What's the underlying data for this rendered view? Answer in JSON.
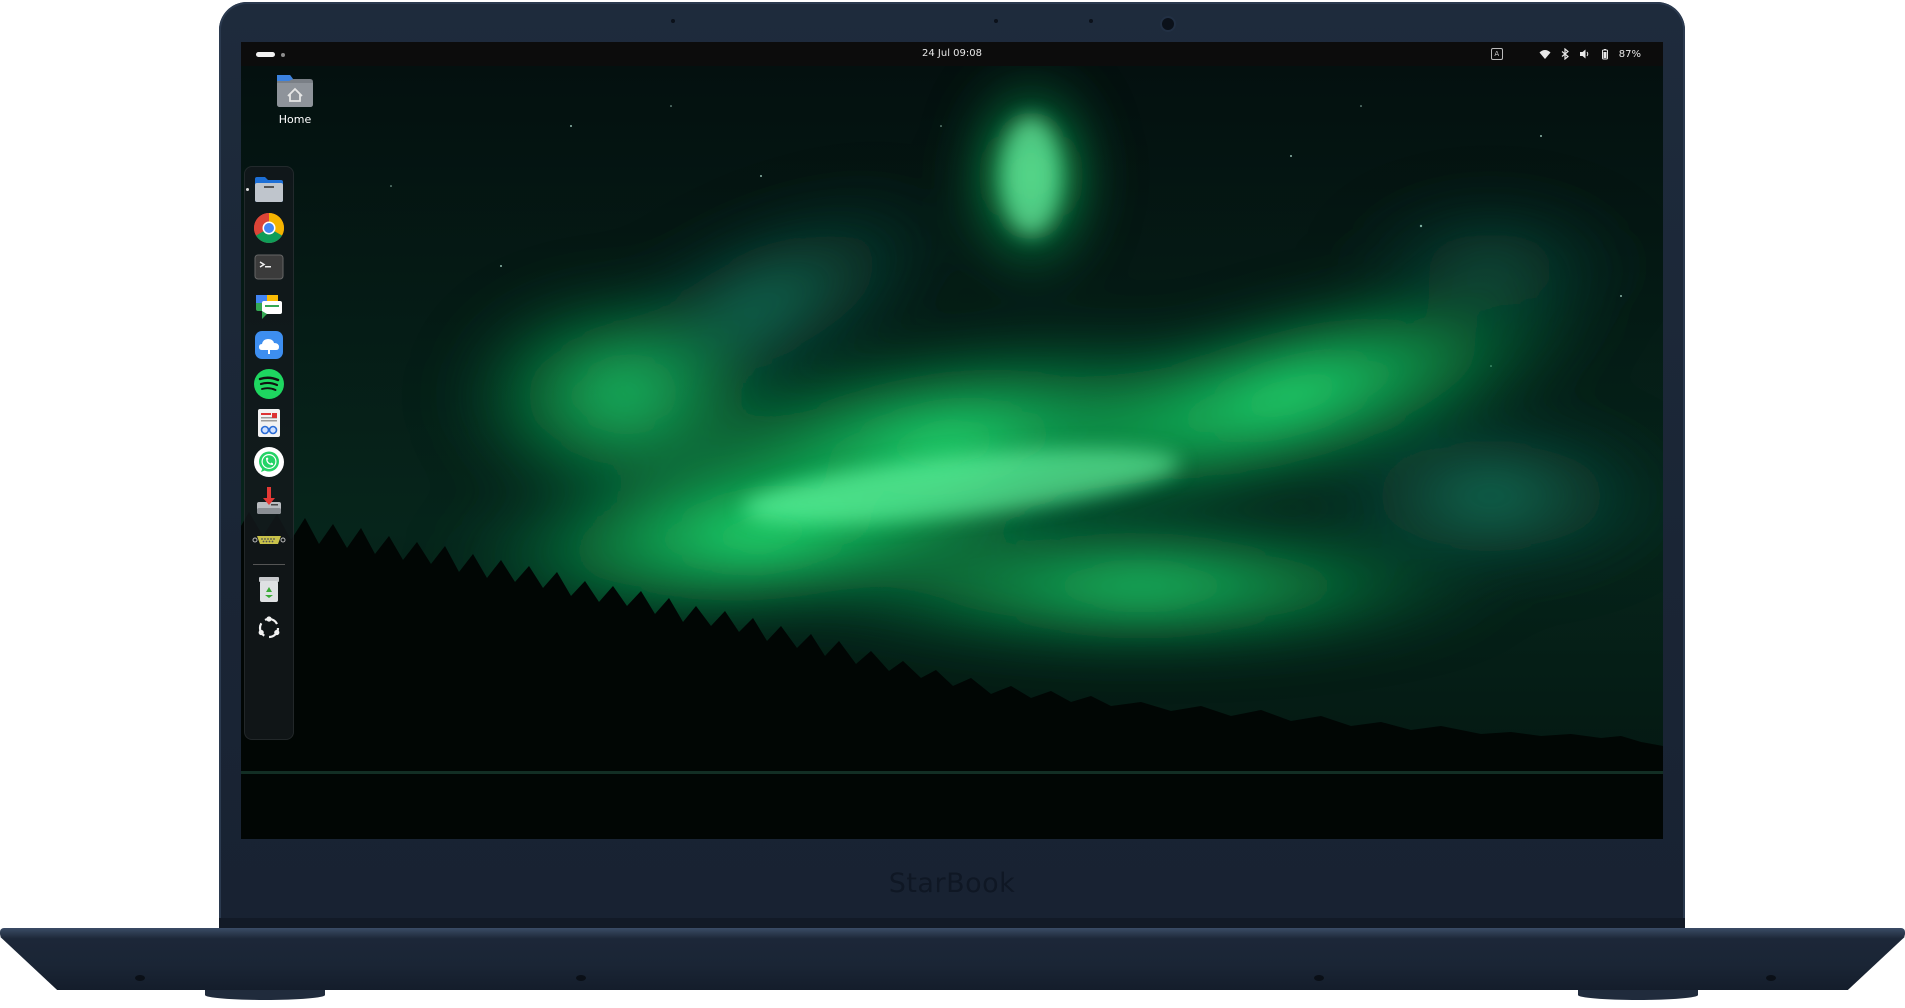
{
  "brand": "StarBook",
  "topbar": {
    "clock": "24 Jul  09:08",
    "keyboard_layout": "A",
    "battery_percent": "87%"
  },
  "desktop": {
    "home_label": "Home"
  },
  "dock": {
    "items": [
      {
        "icon": "files-icon"
      },
      {
        "icon": "chrome-icon"
      },
      {
        "icon": "terminal-icon"
      },
      {
        "icon": "chat-icon"
      },
      {
        "icon": "cloud-icon"
      },
      {
        "icon": "spotify-icon"
      },
      {
        "icon": "document-viewer-icon"
      },
      {
        "icon": "whatsapp-icon"
      },
      {
        "icon": "installer-icon"
      },
      {
        "icon": "serial-port-icon"
      },
      {
        "icon": "trash-icon"
      },
      {
        "icon": "app-grid-icon"
      }
    ]
  },
  "colors": {
    "aurora": "#18e06a",
    "sky": "#04110f",
    "lid": "#1c2737",
    "topbar": "#0c0c0c"
  }
}
